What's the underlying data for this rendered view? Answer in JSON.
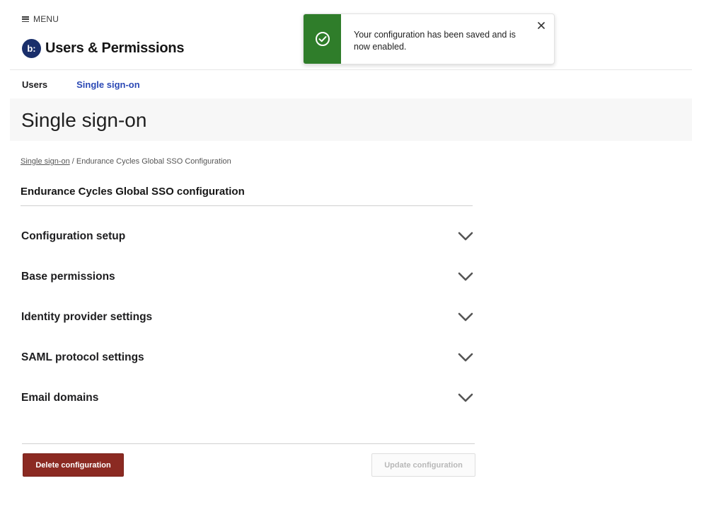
{
  "header": {
    "menu_label": "MENU",
    "logo_text": "b:",
    "app_title": "Users & Permissions",
    "brand_color": "#1a2f6b"
  },
  "tabs": [
    {
      "label": "Users",
      "active": false
    },
    {
      "label": "Single sign-on",
      "active": true
    }
  ],
  "page": {
    "title": "Single sign-on",
    "breadcrumb": {
      "link": "Single sign-on",
      "separator": " / ",
      "current": "Endurance Cycles Global SSO Configuration"
    },
    "section_title": "Endurance Cycles Global SSO configuration"
  },
  "accordion": [
    {
      "label": "Configuration setup",
      "expanded": false
    },
    {
      "label": "Base permissions",
      "expanded": false
    },
    {
      "label": "Identity provider settings",
      "expanded": false
    },
    {
      "label": "SAML protocol settings",
      "expanded": false
    },
    {
      "label": "Email domains",
      "expanded": false
    }
  ],
  "actions": {
    "delete_label": "Delete configuration",
    "update_label": "Update configuration",
    "update_disabled": true,
    "delete_color": "#8b2a22"
  },
  "toast": {
    "message": "Your configuration has been saved and is now enabled.",
    "status": "success",
    "status_color": "#2f7d2a",
    "icon": "check-circle-icon"
  }
}
